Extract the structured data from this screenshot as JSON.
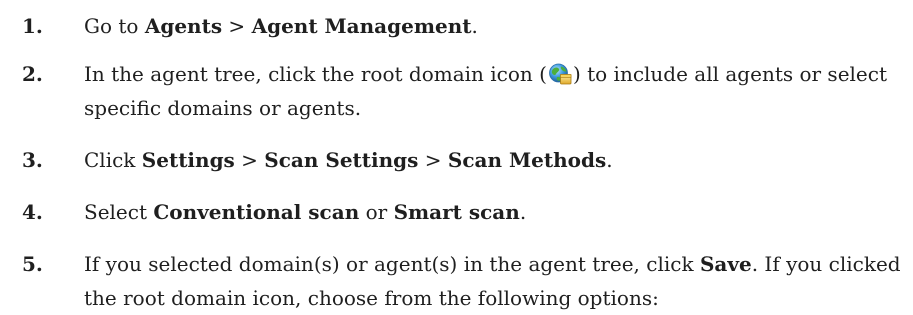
{
  "steps": [
    {
      "number": "1.",
      "parts": [
        "Go to ",
        "Agents",
        " > ",
        "Agent Management",
        "."
      ]
    },
    {
      "number": "2.",
      "parts": [
        "In the agent tree, click the root domain icon (",
        ") to include all agents or select specific domains or agents."
      ],
      "icon": "root-domain-icon"
    },
    {
      "number": "3.",
      "parts": [
        "Click ",
        "Settings",
        " > ",
        "Scan Settings",
        " > ",
        "Scan Methods",
        "."
      ]
    },
    {
      "number": "4.",
      "parts": [
        "Select ",
        "Conventional scan",
        " or ",
        "Smart scan",
        "."
      ]
    },
    {
      "number": "5.",
      "parts": [
        "If you selected domain(s) or agent(s) in the agent tree, click ",
        "Save",
        ". If you clicked the root domain icon, choose from the following options:"
      ]
    }
  ]
}
